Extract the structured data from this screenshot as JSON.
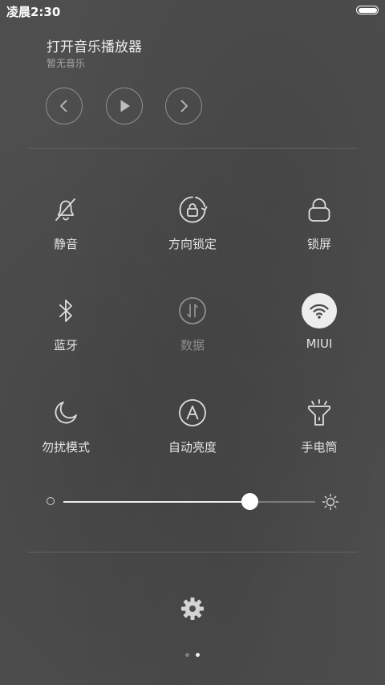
{
  "status_bar": {
    "time": "凌晨2:30"
  },
  "music": {
    "title": "打开音乐播放器",
    "subtitle": "暂无音乐",
    "controls": [
      "chevron-left-icon",
      "play-icon",
      "chevron-right-icon"
    ]
  },
  "toggles": [
    {
      "label": "静音",
      "icon": "bell-off-icon",
      "state": "off"
    },
    {
      "label": "方向锁定",
      "icon": "rotation-lock-icon",
      "state": "off"
    },
    {
      "label": "锁屏",
      "icon": "lock-icon",
      "state": "off"
    },
    {
      "label": "蓝牙",
      "icon": "bluetooth-icon",
      "state": "off"
    },
    {
      "label": "数据",
      "icon": "mobile-data-icon",
      "state": "disabled"
    },
    {
      "label": "MIUI",
      "icon": "wifi-icon",
      "state": "on"
    },
    {
      "label": "勿扰模式",
      "icon": "moon-icon",
      "state": "off"
    },
    {
      "label": "自动亮度",
      "icon": "auto-brightness-icon",
      "state": "off"
    },
    {
      "label": "手电筒",
      "icon": "flashlight-icon",
      "state": "off"
    }
  ],
  "brightness": {
    "level": 0.74
  },
  "pager": {
    "pages": 2,
    "active": 1
  },
  "colors": {
    "background": "#4e4e4e",
    "icon": "#e0e0e0",
    "active_bg": "#ededed",
    "active_icon": "#4a4a4a"
  }
}
